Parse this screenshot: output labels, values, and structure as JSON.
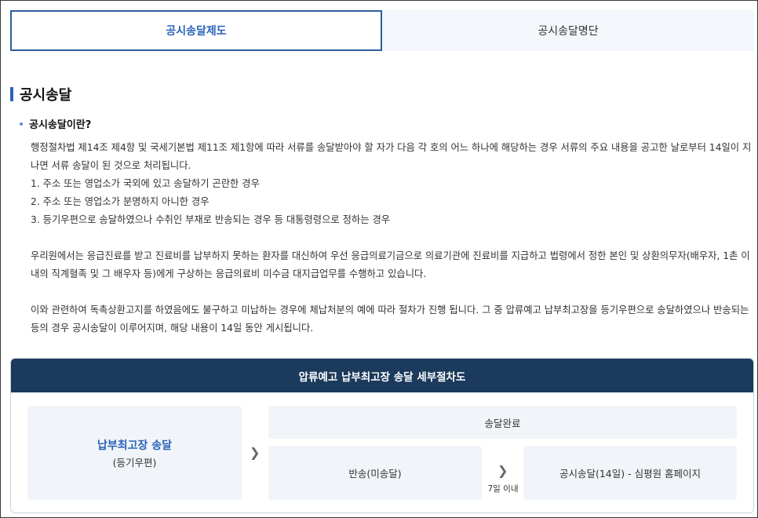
{
  "tabs": [
    {
      "label": "공시송달제도",
      "active": true
    },
    {
      "label": "공시송달명단",
      "active": false
    }
  ],
  "section": {
    "title": "공시송달",
    "subtitle": "공시송달이란?"
  },
  "content": {
    "intro": "행정절차법 제14조 제4항 및 국세기본법 제11조 제1항에 따라 서류를 송달받아야 할 자가 다음 각 호의 어느 하나에 해당하는 경우 서류의 주요 내용을 공고한 날로부터 14일이 지나면 서류 송달이 된 것으로 처리됩니다.",
    "items": [
      "1. 주소 또는 영업소가 국외에 있고 송달하기 곤란한 경우",
      "2. 주소 또는 영업소가 분명하지 아니한 경우",
      "3. 등기우편으로 송달하였으나 수취인 부재로 반송되는 경우 등 대통령령으로 정하는 경우"
    ],
    "para2": "우리원에서는 응급진료를 받고 진료비를 납부하지 못하는 환자를 대신하여 우선 응급의료기금으로 의료기관에 진료비를 지급하고 법령에서 정한 본인 및 상환의무자(배우자, 1촌 이내의 직계혈족 및 그 배우자 등)에게 구상하는 응급의료비 미수금 대지급업무를 수행하고 있습니다.",
    "para3": "이와 관련하여 독촉상환고지를 하였음에도 불구하고 미납하는 경우에 체납처분의 예에 따라 절차가 진행 됩니다. 그 중 압류예고 납부최고장을 등기우편으로 송달하였으나 반송되는 등의 경우 공시송달이 이루어지며, 해당 내용이 14일 동안 게시됩니다."
  },
  "procedure": {
    "title": "압류예고 납부최고장 송달 세부절차도",
    "start_title": "납부최고장 송달",
    "start_sub": "(등기우편)",
    "done": "송달완료",
    "returned": "반송(미송달)",
    "within": "7일 이내",
    "notice": "공시송달(14일) - 심평원 홈페이지"
  },
  "icons": {
    "arrow": "chevron-right-icon"
  },
  "colors": {
    "accent": "#2a63b8",
    "header_bg": "#1b3a5c",
    "box_bg": "#f1f4f8"
  }
}
